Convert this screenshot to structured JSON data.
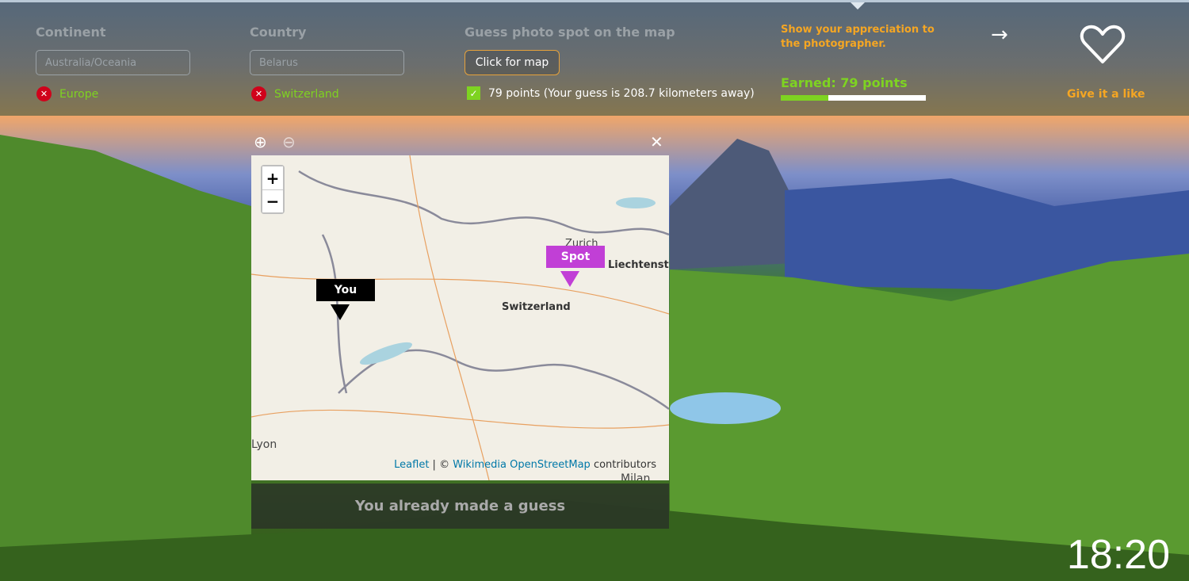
{
  "header": {
    "continent": {
      "label": "Continent",
      "value": "Australia/Oceania",
      "answer": "Europe"
    },
    "country": {
      "label": "Country",
      "value": "Belarus",
      "answer": "Switzerland"
    },
    "spot": {
      "label": "Guess photo spot on the map",
      "button": "Click for map",
      "result": "79 points (Your guess is 208.7 kilometers away)"
    },
    "appreciation": "Show your appreciation to the photographer.",
    "earned": "Earned: 79 points",
    "progress_percent": 33,
    "like_label": "Give it a like"
  },
  "map": {
    "zoom_in": "+",
    "zoom_out": "−",
    "labels": {
      "country": "Switzerland",
      "zurich": "Zurich",
      "liechtenstein": "Liechtenst",
      "lyon": "Lyon",
      "milan": "Milan"
    },
    "pins": {
      "you": "You",
      "spot": "Spot"
    },
    "pin_colors": {
      "you": "#000000",
      "spot": "#c13fd6"
    },
    "attribution": {
      "leaflet": "Leaflet",
      "sep": " | © ",
      "osm": "Wikimedia OpenStreetMap",
      "suffix": " contributors"
    }
  },
  "guess_message": "You already made a guess",
  "clock": "18:20",
  "colors": {
    "accent": "#f5a623",
    "correct": "#7ed321",
    "wrong": "#d0021b"
  }
}
